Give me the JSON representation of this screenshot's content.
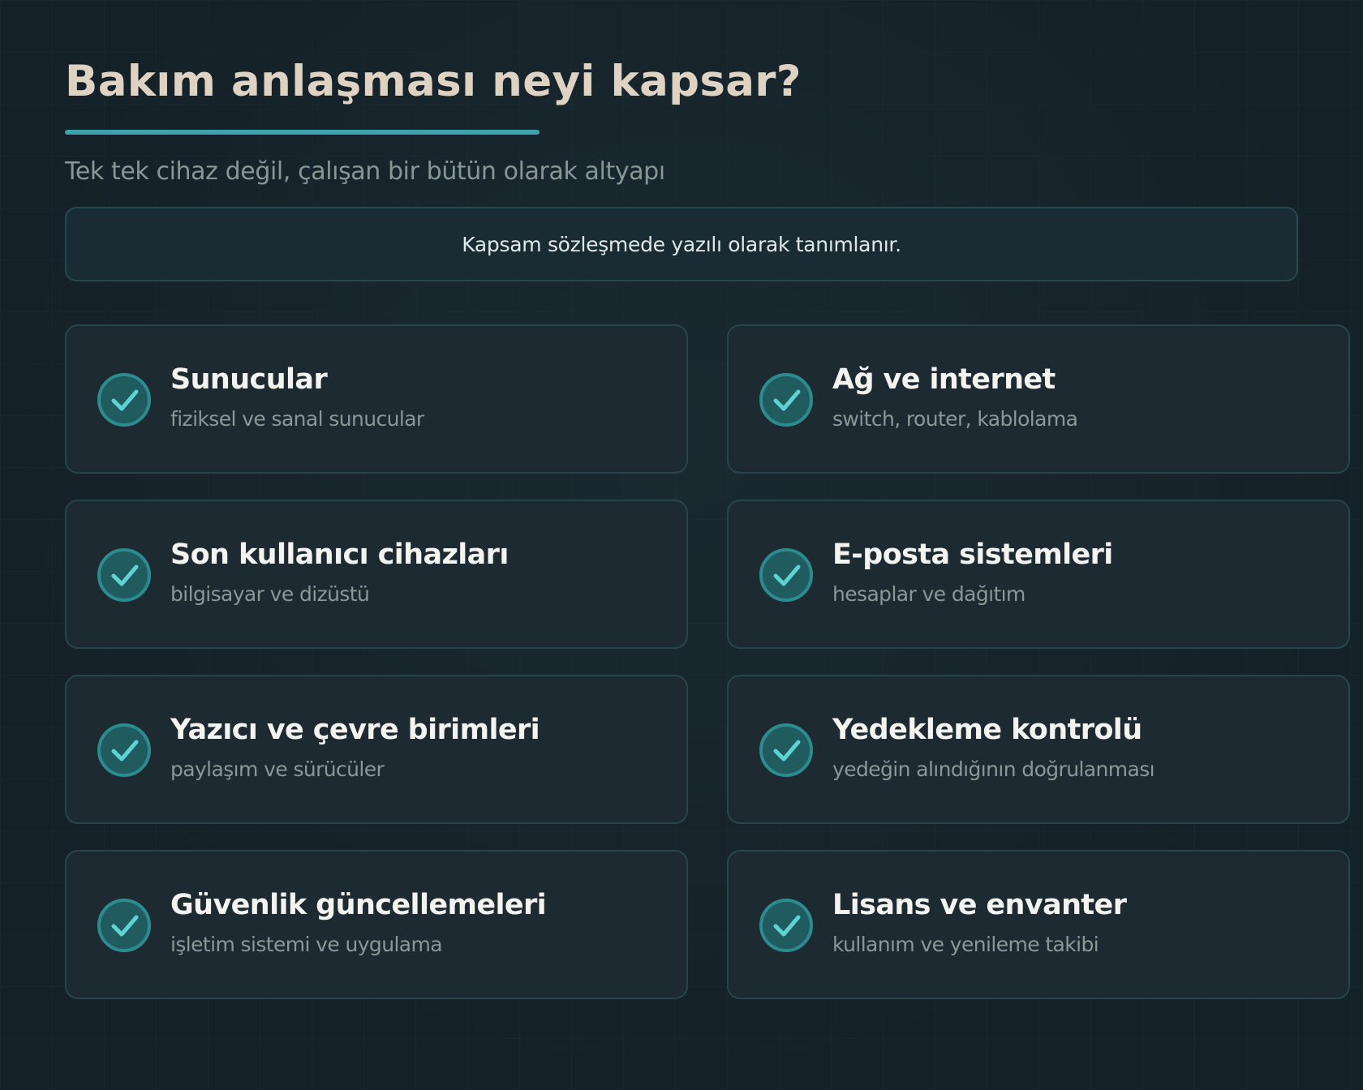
{
  "header": {
    "title": "Bakım anlaşması neyi kapsar?",
    "subtitle": "Tek tek cihaz değil, çalışan bir bütün olarak altyapı"
  },
  "notice": {
    "text": "Kapsam sözleşmede yazılı olarak tanımlanır."
  },
  "colors": {
    "accent": "#3aa6ac",
    "background": "#152128",
    "card_background": "#1e2a31",
    "check_fill": "#1f5b5f"
  },
  "items": [
    {
      "title": "Sunucular",
      "subtitle": "fiziksel ve sanal sunucular",
      "icon": "check-circle-icon"
    },
    {
      "title": "Ağ ve internet",
      "subtitle": "switch, router, kablolama",
      "icon": "check-circle-icon"
    },
    {
      "title": "Son kullanıcı cihazları",
      "subtitle": "bilgisayar ve dizüstü",
      "icon": "check-circle-icon"
    },
    {
      "title": "E-posta sistemleri",
      "subtitle": "hesaplar ve dağıtım",
      "icon": "check-circle-icon"
    },
    {
      "title": "Yazıcı ve çevre birimleri",
      "subtitle": "paylaşım ve sürücüler",
      "icon": "check-circle-icon"
    },
    {
      "title": "Yedekleme kontrolü",
      "subtitle": "yedeğin alındığının doğrulanması",
      "icon": "check-circle-icon"
    },
    {
      "title": "Güvenlik güncellemeleri",
      "subtitle": "işletim sistemi ve uygulama",
      "icon": "check-circle-icon"
    },
    {
      "title": "Lisans ve envanter",
      "subtitle": "kullanım ve yenileme takibi",
      "icon": "check-circle-icon"
    }
  ]
}
